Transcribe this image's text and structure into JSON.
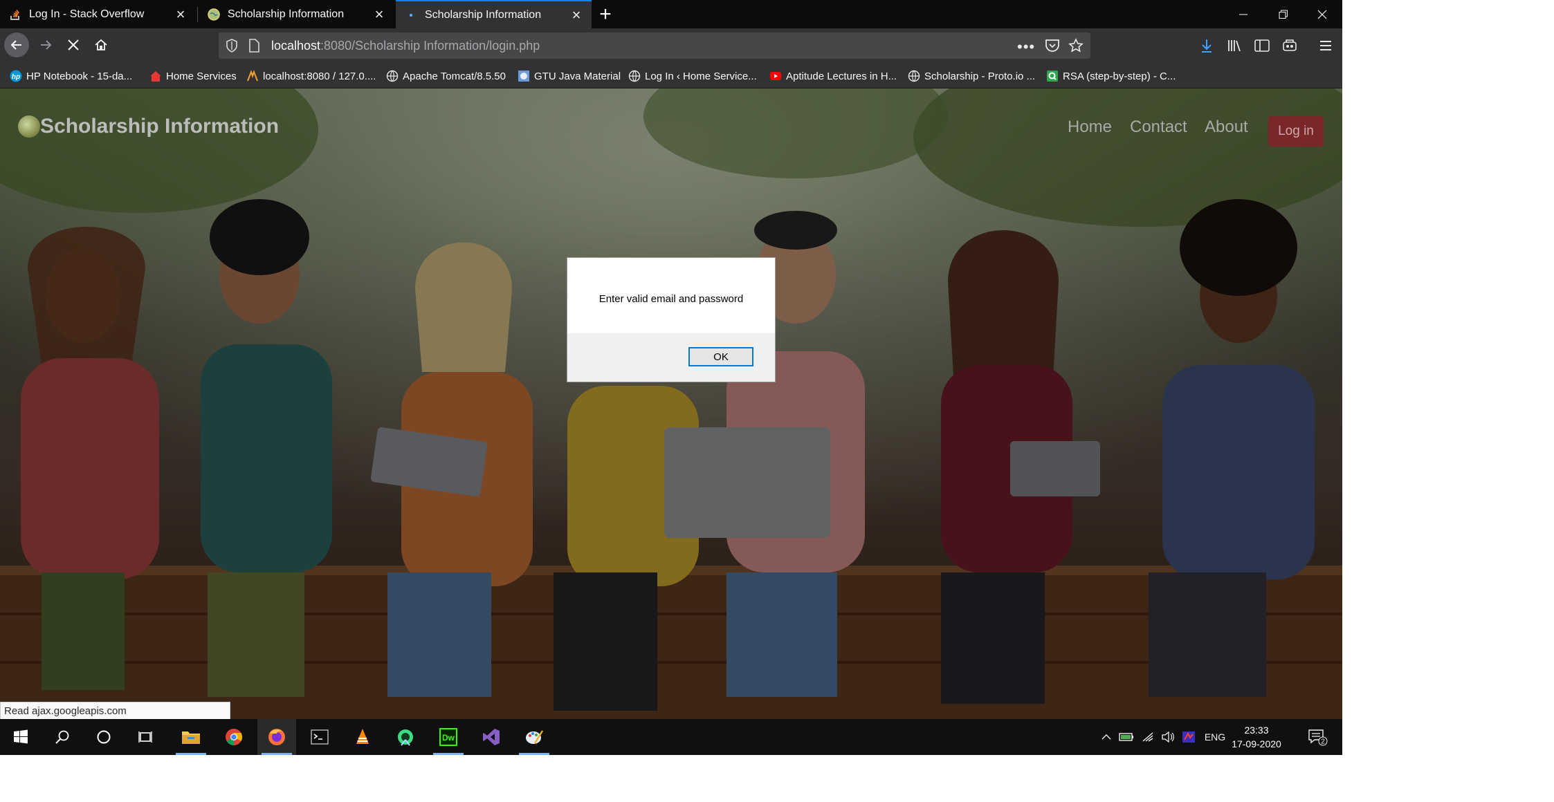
{
  "browser": {
    "tabs": [
      {
        "label": "Log In - Stack Overflow",
        "active": false
      },
      {
        "label": "Scholarship Information",
        "active": false
      },
      {
        "label": "Scholarship Information",
        "active": true
      }
    ],
    "url_host": "localhost",
    "url_rest": ":8080/Scholarship Information/login.php",
    "bookmarks": [
      "HP Notebook - 15-da...",
      "Home Services",
      "localhost:8080 / 127.0....",
      "Apache Tomcat/8.5.50",
      "GTU Java Material",
      "Log In ‹ Home Service...",
      "Aptitude Lectures in H...",
      "Scholarship - Proto.io ...",
      "RSA (step-by-step) - C..."
    ],
    "status_text": "Read ajax.googleapis.com"
  },
  "site": {
    "brand": "Scholarship Information",
    "nav": [
      "Home",
      "Contact",
      "About"
    ],
    "login_label": "Log in"
  },
  "alert": {
    "message": "Enter valid email and password",
    "ok_label": "OK"
  },
  "taskbar": {
    "language": "ENG",
    "time": "23:33",
    "date": "17-09-2020",
    "notification_count": "2",
    "apps": [
      "windows-start",
      "search",
      "cortana",
      "task-view",
      "file-explorer",
      "chrome",
      "firefox",
      "terminal",
      "vlc",
      "android-studio",
      "dreamweaver",
      "visual-studio",
      "paint"
    ]
  },
  "colors": {
    "tab_accent": "#0a84ff",
    "login_button": "#7a2729",
    "ok_focus": "#0078d7"
  }
}
